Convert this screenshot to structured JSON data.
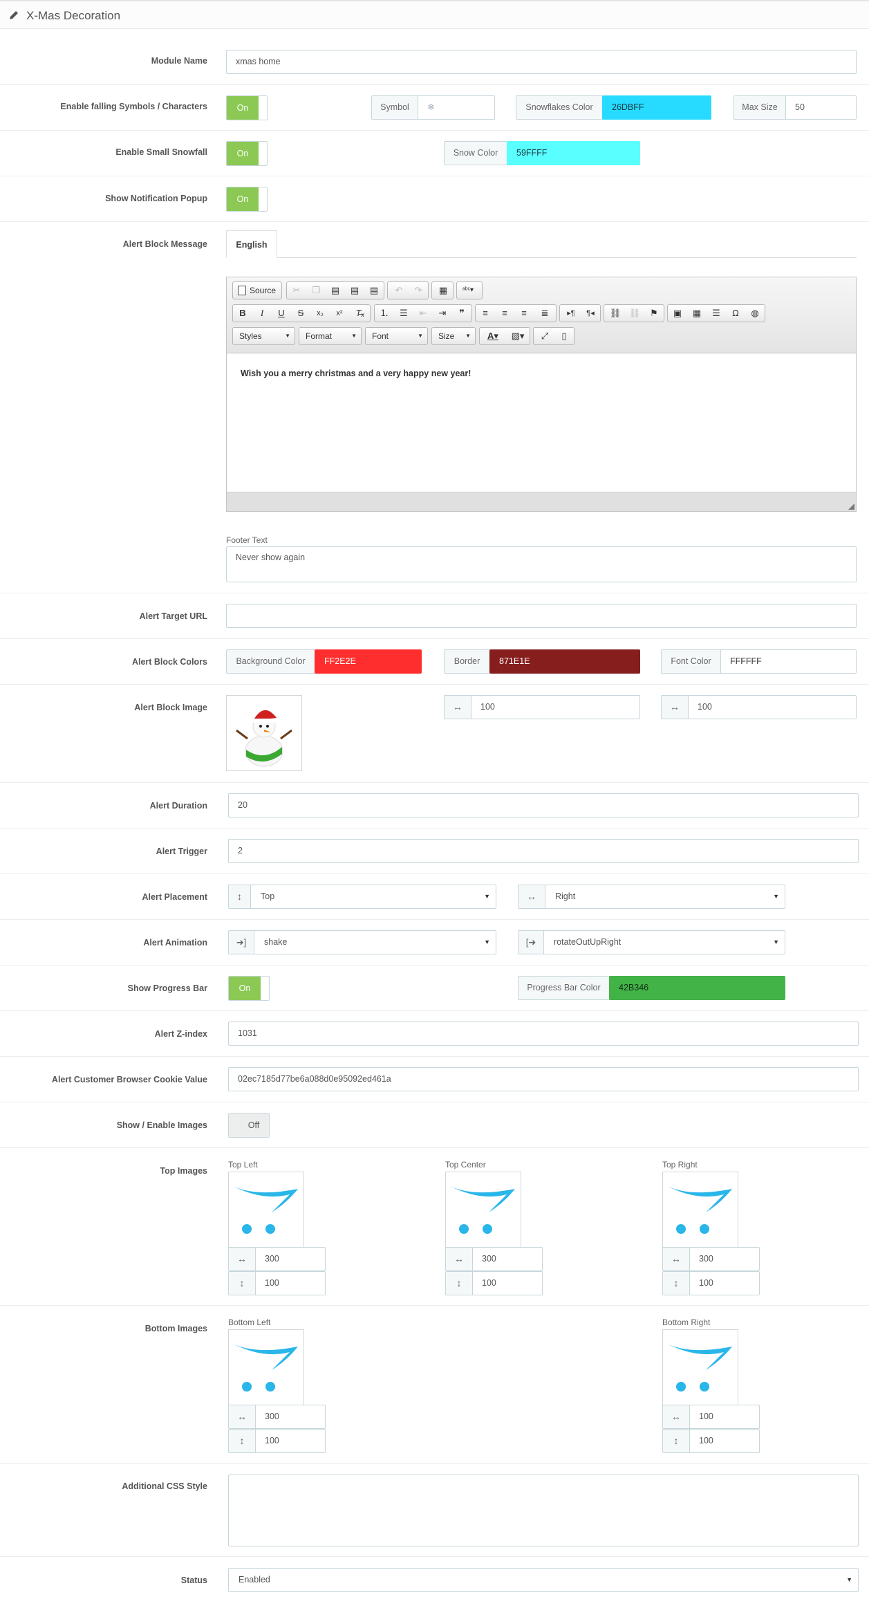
{
  "panel": {
    "title": "X-Mas Decoration"
  },
  "module_name": {
    "label": "Module Name",
    "value": "xmas home"
  },
  "falling": {
    "label": "Enable falling Symbols / Characters",
    "toggle": "On",
    "symbol_label": "Symbol",
    "symbol_value": "❄",
    "flakes_color_label": "Snowflakes Color",
    "flakes_color": "26DBFF",
    "max_size_label": "Max Size",
    "max_size": "50"
  },
  "small_snow": {
    "label": "Enable Small Snowfall",
    "toggle": "On",
    "color_label": "Snow Color",
    "color": "59FFFF"
  },
  "notification": {
    "label": "Show Notification Popup",
    "toggle": "On"
  },
  "alert_message": {
    "label": "Alert Block Message",
    "tab": "English",
    "toolbar": {
      "source": "Source",
      "styles": "Styles",
      "format": "Format",
      "font": "Font",
      "size": "Size"
    },
    "content": "Wish you a merry christmas and a very happy new year!",
    "footer_label": "Footer Text",
    "footer_value": "Never show again"
  },
  "target_url": {
    "label": "Alert Target URL",
    "value": ""
  },
  "colors": {
    "label": "Alert Block Colors",
    "bg_label": "Background Color",
    "bg": "FF2E2E",
    "border_label": "Border",
    "border": "871E1E",
    "font_label": "Font Color",
    "font": "FFFFFF"
  },
  "block_image": {
    "label": "Alert Block Image",
    "width": "100",
    "height": "100"
  },
  "duration": {
    "label": "Alert Duration",
    "value": "20"
  },
  "trigger": {
    "label": "Alert Trigger",
    "value": "2"
  },
  "placement": {
    "label": "Alert Placement",
    "vertical": "Top",
    "horizontal": "Right"
  },
  "animation": {
    "label": "Alert Animation",
    "in": "shake",
    "out": "rotateOutUpRight"
  },
  "progress": {
    "label": "Show Progress Bar",
    "toggle": "On",
    "color_label": "Progress Bar Color",
    "color": "42B346"
  },
  "zindex": {
    "label": "Alert Z-index",
    "value": "1031"
  },
  "cookie": {
    "label": "Alert Customer Browser Cookie Value",
    "value": "02ec7185d77be6a088d0e95092ed461a"
  },
  "images_toggle": {
    "label": "Show / Enable Images",
    "toggle": "Off"
  },
  "top_images": {
    "label": "Top Images",
    "items": [
      {
        "name": "Top Left",
        "width": "300",
        "height": "100"
      },
      {
        "name": "Top Center",
        "width": "300",
        "height": "100"
      },
      {
        "name": "Top Right",
        "width": "300",
        "height": "100"
      }
    ]
  },
  "bottom_images": {
    "label": "Bottom Images",
    "items": [
      {
        "name": "Bottom Left",
        "width": "300",
        "height": "100"
      },
      {
        "name": "Bottom Right",
        "width": "100",
        "height": "100"
      }
    ]
  },
  "css": {
    "label": "Additional CSS Style",
    "value": ""
  },
  "status": {
    "label": "Status",
    "value": "Enabled"
  },
  "colors_hex": {
    "toggle_on": "#8bc954",
    "accent_cyan": "#26dbff"
  }
}
